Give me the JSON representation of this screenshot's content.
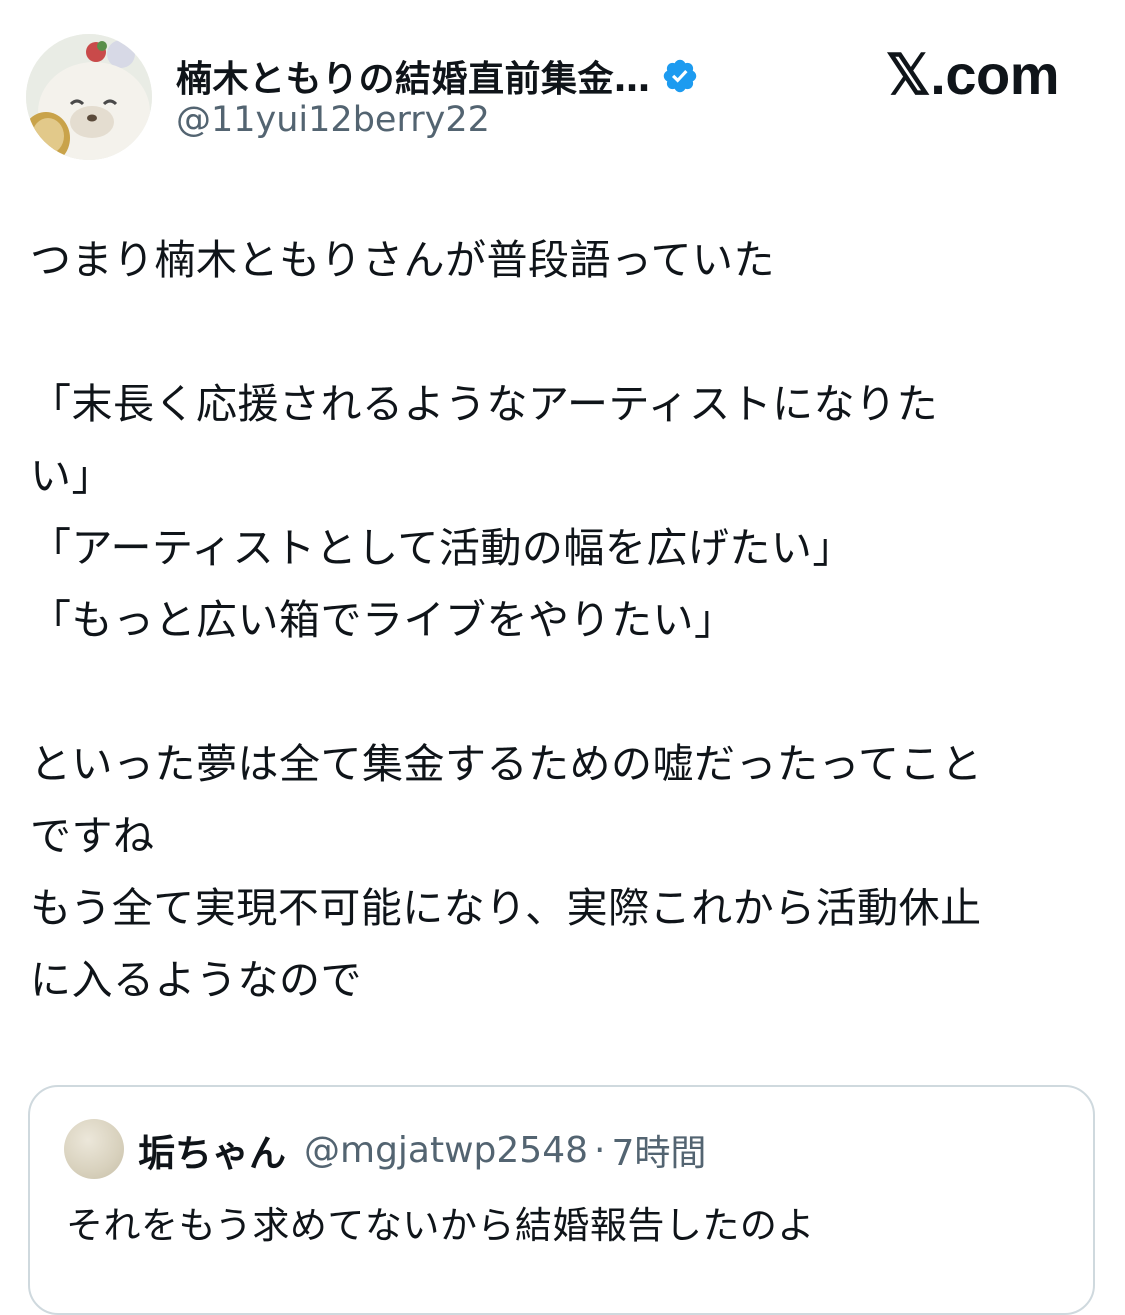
{
  "author": {
    "display_name": "楠木ともりの結婚直前集金…",
    "handle": "@11yui12berry22",
    "avatar_icon": "avatar-photo",
    "verified_icon": "verified-badge-icon",
    "verified_color": "#1d9bf0"
  },
  "site_brand": "𝕏.com",
  "tweet": {
    "lines": [
      "つまり楠木ともりさんが普段語っていた",
      "",
      "「末長く応援されるようなアーティストになりた",
      "い」",
      "「アーティストとして活動の幅を広げたい」",
      "「もっと広い箱でライブをやりたい」",
      "",
      "といった夢は全て集金するための嘘だったってこと",
      "ですね",
      "もう全て実現不可能になり、実際これから活動休止",
      "に入るようなので"
    ]
  },
  "quote": {
    "display_name": "垢ちゃん",
    "handle": "@mgjatwp2548",
    "separator": "·",
    "time": "7時間",
    "text": "それをもう求めてないから結婚報告したのよ"
  },
  "colors": {
    "text_primary": "#0f1419",
    "text_secondary": "#536471",
    "border": "#cfd9de"
  }
}
